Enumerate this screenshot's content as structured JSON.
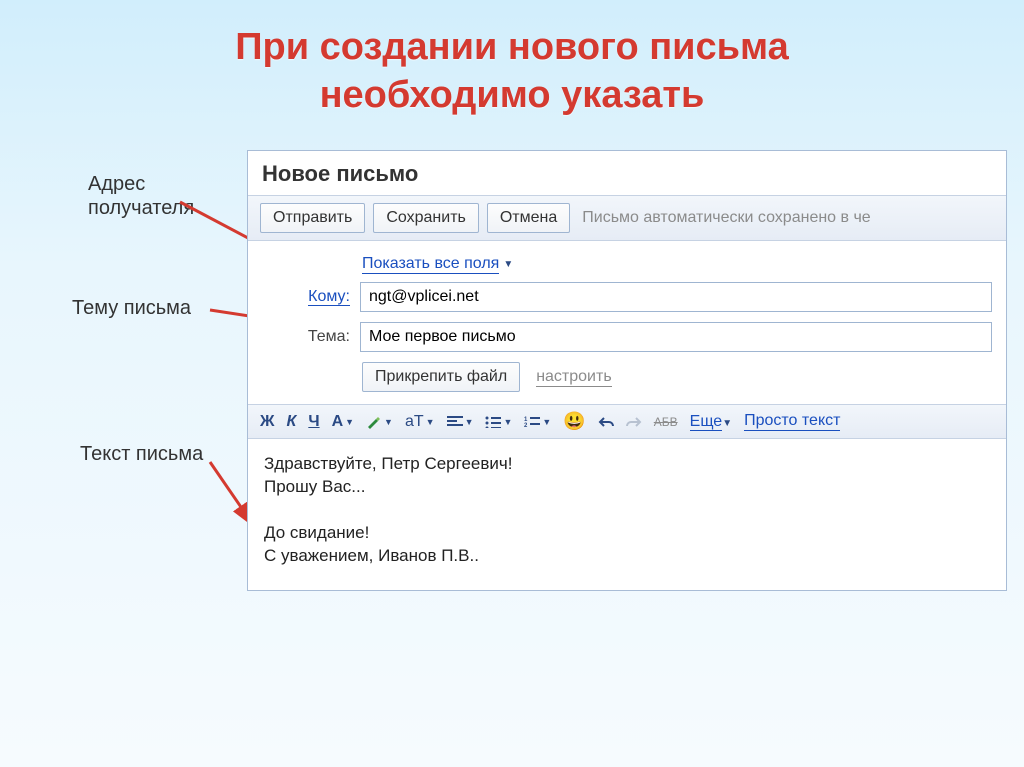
{
  "slide": {
    "title_line1": "При создании нового письма",
    "title_line2": "необходимо указать"
  },
  "labels": {
    "recipient_l1": "Адрес",
    "recipient_l2": "получателя",
    "subject": "Тему письма",
    "body": "Текст письма"
  },
  "app": {
    "window_title": "Новое письмо",
    "toolbar": {
      "send": "Отправить",
      "save": "Сохранить",
      "cancel": "Отмена",
      "status": "Письмо автоматически сохранено в че"
    },
    "links": {
      "show_all_fields": "Показать все поля",
      "to_label": "Кому:",
      "configure": "настроить",
      "more": "Еще",
      "plain_text": "Просто текст"
    },
    "fields": {
      "subject_label": "Тема:",
      "to_value": "ngt@vplicei.net",
      "subject_value": "Мое первое письмо"
    },
    "attach_btn": "Прикрепить файл",
    "format": {
      "bold": "Ж",
      "italic": "К",
      "underline": "Ч",
      "color_A": "А",
      "size_T": "аТ",
      "strike": "АБВ"
    },
    "body_text": "Здравствуйте, Петр Сергеевич!\nПрошу Вас...\n\nДо свидание!\nС уважением, Иванов П.В.."
  }
}
